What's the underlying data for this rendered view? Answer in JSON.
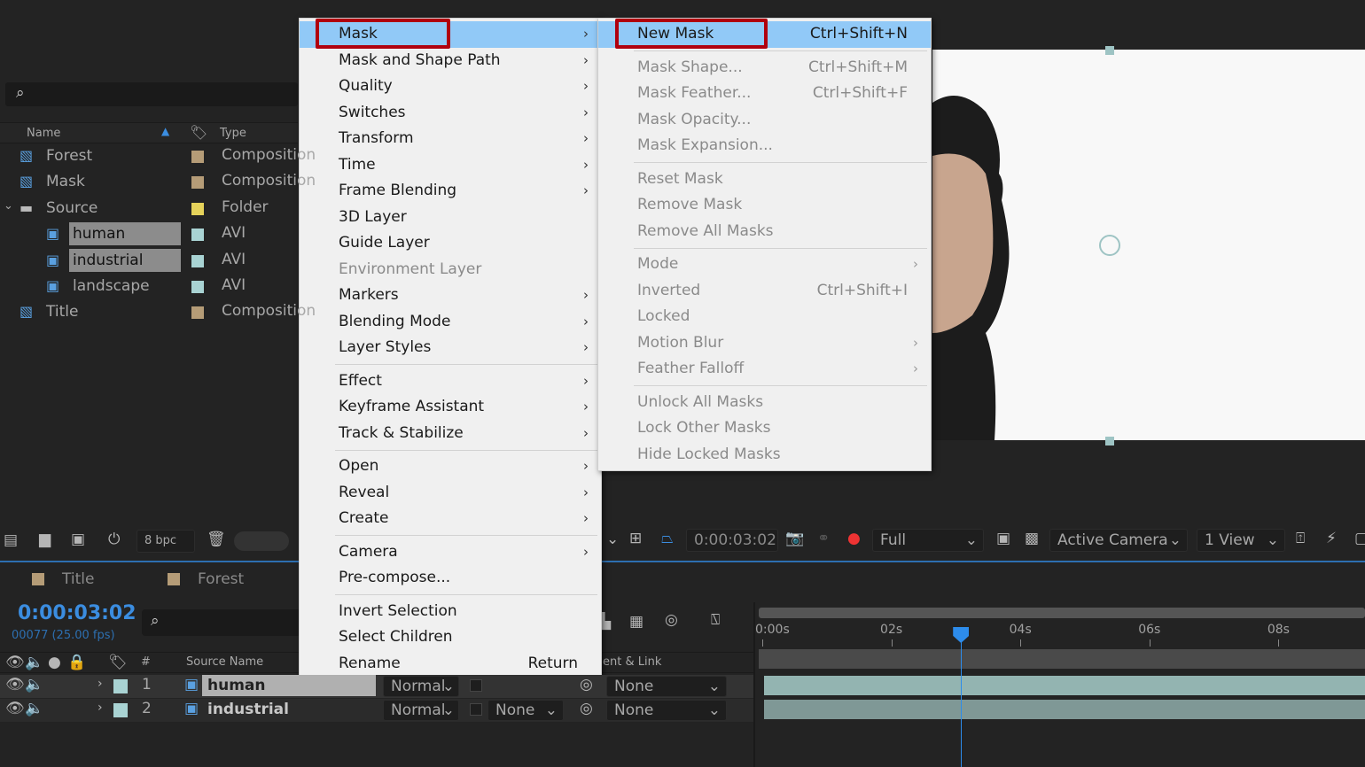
{
  "project": {
    "search_placeholder": "",
    "columns": {
      "name": "Name",
      "type": "Type"
    },
    "items": [
      {
        "name": "Forest",
        "type": "Composition",
        "label_color": "#b59c77",
        "icon": "composition-icon",
        "indent": 0,
        "selected": false
      },
      {
        "name": "Mask",
        "type": "Composition",
        "label_color": "#b59c77",
        "icon": "composition-icon",
        "indent": 0,
        "selected": false
      },
      {
        "name": "Source",
        "type": "Folder",
        "label_color": "#e5d25a",
        "icon": "folder-icon",
        "indent": 0,
        "selected": false,
        "expanded": true
      },
      {
        "name": "human",
        "type": "AVI",
        "label_color": "#a9d3d3",
        "icon": "video-file-icon",
        "indent": 1,
        "selected": true
      },
      {
        "name": "industrial",
        "type": "AVI",
        "label_color": "#a9d3d3",
        "icon": "video-file-icon",
        "indent": 1,
        "selected": true
      },
      {
        "name": "landscape",
        "type": "AVI",
        "label_color": "#a9d3d3",
        "icon": "video-file-icon",
        "indent": 1,
        "selected": false
      },
      {
        "name": "Title",
        "type": "Composition",
        "label_color": "#b59c77",
        "icon": "composition-icon",
        "indent": 0,
        "selected": false
      }
    ],
    "bpc": "8 bpc"
  },
  "context_menu": [
    {
      "label": "Mask",
      "submenu": true,
      "highlighted": true
    },
    {
      "label": "Mask and Shape Path",
      "submenu": true
    },
    {
      "label": "Quality",
      "submenu": true
    },
    {
      "label": "Switches",
      "submenu": true
    },
    {
      "label": "Transform",
      "submenu": true
    },
    {
      "label": "Time",
      "submenu": true
    },
    {
      "label": "Frame Blending",
      "submenu": true
    },
    {
      "label": "3D Layer"
    },
    {
      "label": "Guide Layer"
    },
    {
      "label": "Environment Layer",
      "disabled": true
    },
    {
      "label": "Markers",
      "submenu": true
    },
    {
      "label": "Blending Mode",
      "submenu": true
    },
    {
      "label": "Layer Styles",
      "submenu": true
    },
    {
      "separator": true
    },
    {
      "label": "Effect",
      "submenu": true
    },
    {
      "label": "Keyframe Assistant",
      "submenu": true
    },
    {
      "label": "Track & Stabilize",
      "submenu": true
    },
    {
      "separator": true
    },
    {
      "label": "Open",
      "submenu": true
    },
    {
      "label": "Reveal",
      "submenu": true
    },
    {
      "label": "Create",
      "submenu": true
    },
    {
      "separator": true
    },
    {
      "label": "Camera",
      "submenu": true
    },
    {
      "label": "Pre-compose..."
    },
    {
      "separator": true
    },
    {
      "label": "Invert Selection"
    },
    {
      "label": "Select Children"
    },
    {
      "label": "Rename",
      "shortcut": "Return"
    }
  ],
  "mask_submenu": [
    {
      "label": "New Mask",
      "shortcut": "Ctrl+Shift+N",
      "highlighted": true
    },
    {
      "separator": true
    },
    {
      "label": "Mask Shape...",
      "shortcut": "Ctrl+Shift+M",
      "disabled": true
    },
    {
      "label": "Mask Feather...",
      "shortcut": "Ctrl+Shift+F",
      "disabled": true
    },
    {
      "label": "Mask Opacity...",
      "disabled": true
    },
    {
      "label": "Mask Expansion...",
      "disabled": true
    },
    {
      "separator": true
    },
    {
      "label": "Reset Mask",
      "disabled": true
    },
    {
      "label": "Remove Mask",
      "disabled": true
    },
    {
      "label": "Remove All Masks",
      "disabled": true
    },
    {
      "separator": true
    },
    {
      "label": "Mode",
      "submenu": true,
      "disabled": true
    },
    {
      "label": "Inverted",
      "shortcut": "Ctrl+Shift+I",
      "disabled": true
    },
    {
      "label": "Locked",
      "disabled": true
    },
    {
      "label": "Motion Blur",
      "submenu": true,
      "disabled": true
    },
    {
      "label": "Feather Falloff",
      "submenu": true,
      "disabled": true
    },
    {
      "separator": true
    },
    {
      "label": "Unlock All Masks",
      "disabled": true
    },
    {
      "label": "Lock Other Masks",
      "disabled": true
    },
    {
      "label": "Hide Locked Masks",
      "disabled": true
    }
  ],
  "viewer": {
    "timecode": "0:00:03:02",
    "resolution": "Full",
    "camera": "Active Camera",
    "views": "1 View"
  },
  "timeline": {
    "tabs": [
      "Title",
      "Forest"
    ],
    "tab_color": "#b59c77",
    "timecode": "0:00:03:02",
    "frame_info": "00077 (25.00 fps)",
    "columns": {
      "num": "#",
      "source_name": "Source Name",
      "parent": "ent & Link"
    },
    "layers": [
      {
        "num": "1",
        "name": "human",
        "mode": "Normal",
        "trkmat": "",
        "parent": "None",
        "selected": true
      },
      {
        "num": "2",
        "name": "industrial",
        "mode": "Normal",
        "trkmat": "None",
        "parent": "None",
        "selected": false
      }
    ],
    "ruler": [
      "0:00s",
      "02s",
      "04s",
      "06s",
      "08s"
    ],
    "current_time_s": 3.08,
    "accent": "#2d8ceb"
  }
}
